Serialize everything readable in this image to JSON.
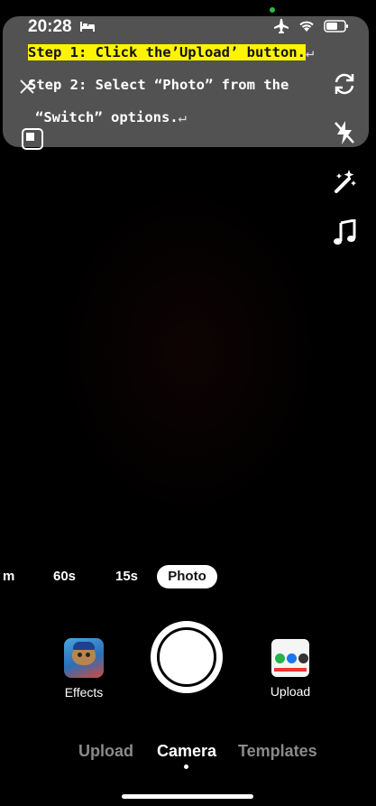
{
  "status_bar": {
    "time": "20:28",
    "icons": [
      "bed-icon",
      "airplane-icon",
      "wifi-icon",
      "battery-icon"
    ]
  },
  "instructions": {
    "line1": "Step 1: Click the’Upload’ button.",
    "line2": "Step 2: Select “Photo” from the",
    "line3": "“Switch” options.",
    "return_mark": "↵",
    "highlight_color": "#fff400"
  },
  "top_controls": {
    "icons": [
      "close-icon",
      "flip-camera-icon",
      "square-icon",
      "flash-off-icon",
      "magic-wand-icon",
      "music-note-icon"
    ]
  },
  "durations": {
    "items": [
      "m",
      "60s",
      "15s",
      "Photo"
    ],
    "selected": "Photo"
  },
  "capture_row": {
    "effects_label": "Effects",
    "upload_label": "Upload"
  },
  "bottom_tabs": {
    "items": [
      "Upload",
      "Camera",
      "Templates"
    ],
    "active": "Camera"
  },
  "colors": {
    "background": "#000000",
    "inactive_tab": "#8a8a8a",
    "active_tab": "#ffffff"
  }
}
